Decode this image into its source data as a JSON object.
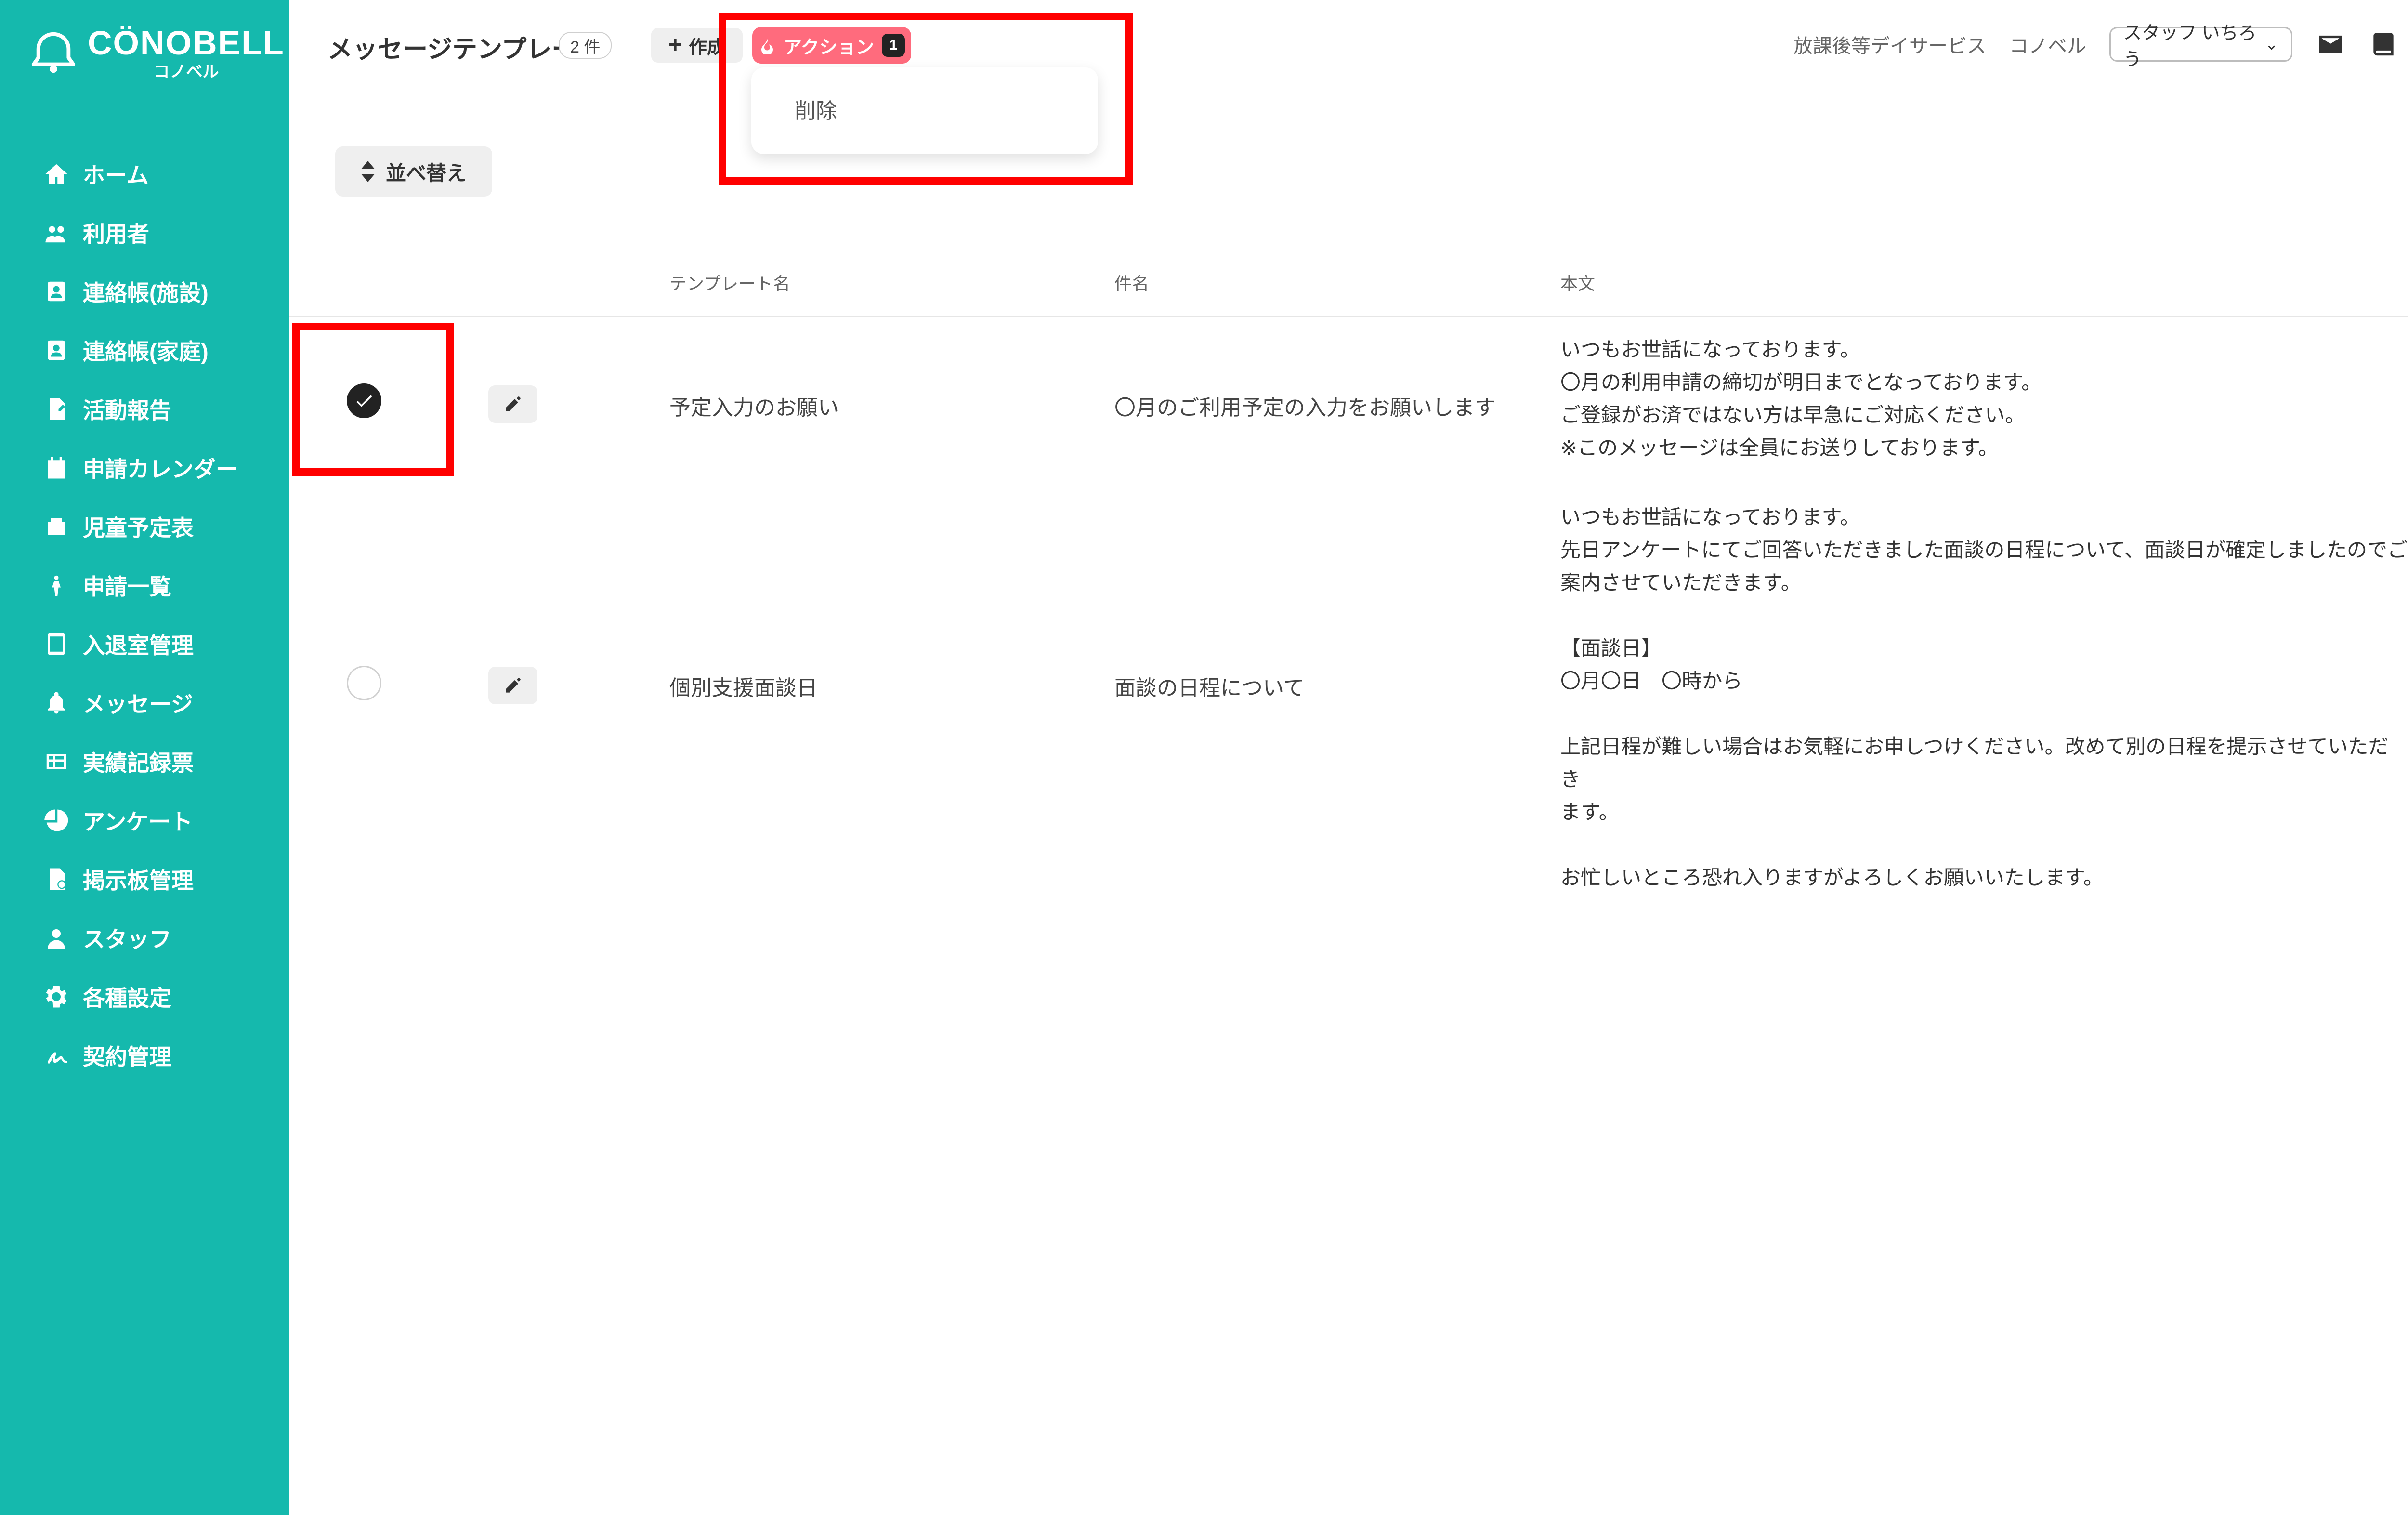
{
  "sidebar": {
    "brand": {
      "main": "CÖNOBELL",
      "sub": "コノベル"
    },
    "items": [
      {
        "label": "ホーム",
        "icon": "home-icon"
      },
      {
        "label": "利用者",
        "icon": "users-icon"
      },
      {
        "label": "連絡帳(施設)",
        "icon": "contact-card-icon"
      },
      {
        "label": "連絡帳(家庭)",
        "icon": "contact-card-icon"
      },
      {
        "label": "活動報告",
        "icon": "file-edit-icon"
      },
      {
        "label": "申請カレンダー",
        "icon": "calendar-icon"
      },
      {
        "label": "児童予定表",
        "icon": "schedule-icon"
      },
      {
        "label": "申請一覧",
        "icon": "child-icon"
      },
      {
        "label": "入退室管理",
        "icon": "tablet-icon"
      },
      {
        "label": "メッセージ",
        "icon": "bell-icon"
      },
      {
        "label": "実績記録票",
        "icon": "table-icon"
      },
      {
        "label": "アンケート",
        "icon": "pie-chart-icon"
      },
      {
        "label": "掲示板管理",
        "icon": "file-image-icon"
      },
      {
        "label": "スタッフ",
        "icon": "user-icon"
      },
      {
        "label": "各種設定",
        "icon": "gear-icon"
      },
      {
        "label": "契約管理",
        "icon": "signature-icon"
      }
    ]
  },
  "header": {
    "title": "メッセージテンプレート",
    "count": "2 件",
    "create_label": "作成",
    "action_label": "アクション",
    "action_badge": "1",
    "dropdown_delete": "削除",
    "org_name": "放課後等デイサービス",
    "org_sub": "コノベル",
    "staff_selected": "スタッフ いちろう"
  },
  "toolbar": {
    "sort_label": "並べ替え"
  },
  "table": {
    "columns": [
      "テンプレート名",
      "件名",
      "本文"
    ],
    "rows": [
      {
        "checked": true,
        "name": "予定入力のお願い",
        "subject": "〇月のご利用予定の入力をお願いします",
        "body": "いつもお世話になっております。\n〇月の利用申請の締切が明日までとなっております。\nご登録がお済ではない方は早急にご対応ください。\n※このメッセージは全員にお送りしております。"
      },
      {
        "checked": false,
        "name": "個別支援面談日",
        "subject": "面談の日程について",
        "body": "いつもお世話になっております。\n先日アンケートにてご回答いただきました面談の日程について、面談日が確定しましたのでご\n案内させていただきます。\n\n【面談日】\n〇月〇日　〇時から\n\n上記日程が難しい場合はお気軽にお申しつけください。改めて別の日程を提示させていただき\nます。\n\nお忙しいところ恐れ入りますがよろしくお願いいたします。"
      }
    ]
  },
  "colors": {
    "sidebar": "#15b9ad",
    "highlight": "#ff0000",
    "action_button": "#ff6b7d"
  }
}
